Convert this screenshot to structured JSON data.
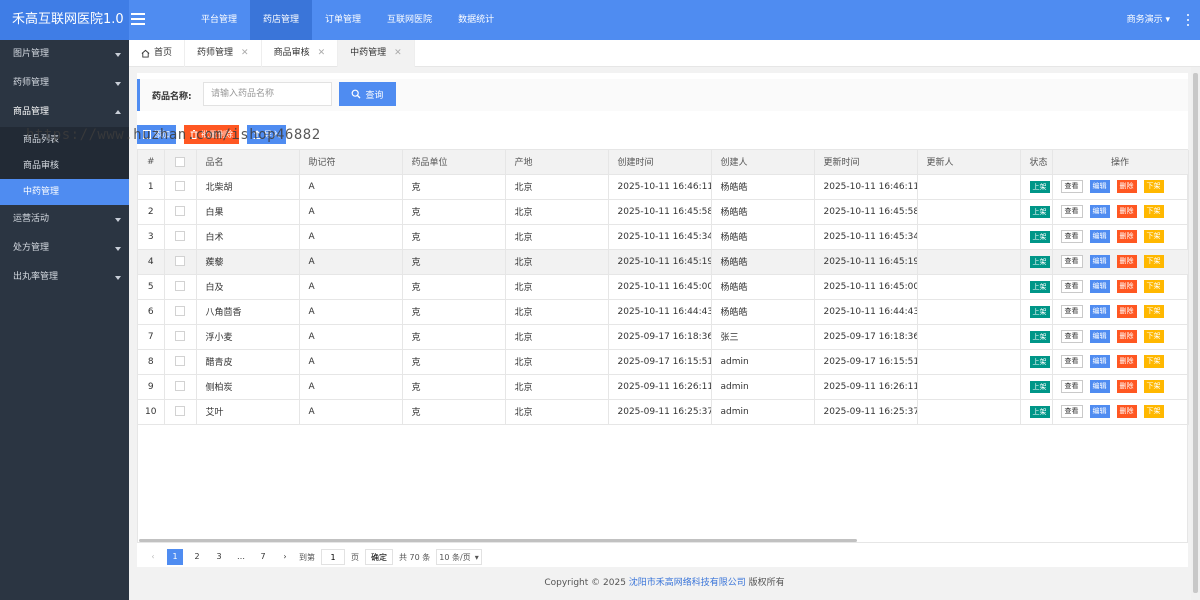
{
  "app": {
    "title": "禾高互联网医院1.0"
  },
  "topnav": {
    "items": [
      "平台管理",
      "药店管理",
      "订单管理",
      "互联网医院",
      "数据统计"
    ],
    "active_index": 1,
    "user": "商务演示"
  },
  "sidebar": {
    "items": [
      {
        "label": "图片管理",
        "state": "collapsed"
      },
      {
        "label": "药师管理",
        "state": "collapsed"
      },
      {
        "label": "商品管理",
        "state": "expanded"
      },
      {
        "label": "运营活动",
        "state": "collapsed"
      },
      {
        "label": "处方管理",
        "state": "collapsed"
      },
      {
        "label": "出丸率管理",
        "state": "collapsed"
      }
    ],
    "sub_items": [
      "商品列表",
      "商品审核",
      "中药管理"
    ],
    "active_sub": "中药管理"
  },
  "tabs": [
    {
      "label": "首页",
      "icon": "home-icon",
      "closable": false
    },
    {
      "label": "药师管理",
      "closable": true
    },
    {
      "label": "商品审核",
      "closable": true
    },
    {
      "label": "中药管理",
      "closable": true,
      "active": true
    }
  ],
  "search": {
    "label": "药品名称:",
    "placeholder": "请输入药品名称",
    "button": "查询"
  },
  "actions": {
    "add": "添加",
    "batch_delete": "批量删除",
    "import": "导入"
  },
  "watermark": "https://www.huzhan.com/ishop46882",
  "table": {
    "columns": [
      "#",
      "",
      "品名",
      "助记符",
      "药品单位",
      "产地",
      "创建时间",
      "创建人",
      "更新时间",
      "更新人",
      "状态",
      "操作"
    ],
    "status_label": "上架",
    "op_labels": {
      "view": "查看",
      "edit": "编辑",
      "delete": "删除",
      "offshelf": "下架"
    },
    "rows": [
      {
        "no": "1",
        "name": "北柴胡",
        "mnemonic": "A",
        "unit": "克",
        "origin": "北京",
        "created": "2025-10-11 16:46:11",
        "creator": "杨皓皓",
        "updated": "2025-10-11 16:46:11",
        "updater": ""
      },
      {
        "no": "2",
        "name": "白果",
        "mnemonic": "A",
        "unit": "克",
        "origin": "北京",
        "created": "2025-10-11 16:45:58",
        "creator": "杨皓皓",
        "updated": "2025-10-11 16:45:58",
        "updater": ""
      },
      {
        "no": "3",
        "name": "白术",
        "mnemonic": "A",
        "unit": "克",
        "origin": "北京",
        "created": "2025-10-11 16:45:34",
        "creator": "杨皓皓",
        "updated": "2025-10-11 16:45:34",
        "updater": ""
      },
      {
        "no": "4",
        "name": "蒺藜",
        "mnemonic": "A",
        "unit": "克",
        "origin": "北京",
        "created": "2025-10-11 16:45:19",
        "creator": "杨皓皓",
        "updated": "2025-10-11 16:45:19",
        "updater": ""
      },
      {
        "no": "5",
        "name": "白及",
        "mnemonic": "A",
        "unit": "克",
        "origin": "北京",
        "created": "2025-10-11 16:45:00",
        "creator": "杨皓皓",
        "updated": "2025-10-11 16:45:00",
        "updater": ""
      },
      {
        "no": "6",
        "name": "八角茴香",
        "mnemonic": "A",
        "unit": "克",
        "origin": "北京",
        "created": "2025-10-11 16:44:43",
        "creator": "杨皓皓",
        "updated": "2025-10-11 16:44:43",
        "updater": ""
      },
      {
        "no": "7",
        "name": "浮小麦",
        "mnemonic": "A",
        "unit": "克",
        "origin": "北京",
        "created": "2025-09-17 16:18:36",
        "creator": "张三",
        "updated": "2025-09-17 16:18:36",
        "updater": ""
      },
      {
        "no": "8",
        "name": "醋青皮",
        "mnemonic": "A",
        "unit": "克",
        "origin": "北京",
        "created": "2025-09-17 16:15:51",
        "creator": "admin",
        "updated": "2025-09-17 16:15:51",
        "updater": ""
      },
      {
        "no": "9",
        "name": "侧柏炭",
        "mnemonic": "A",
        "unit": "克",
        "origin": "北京",
        "created": "2025-09-11 16:26:11",
        "creator": "admin",
        "updated": "2025-09-11 16:26:11",
        "updater": ""
      },
      {
        "no": "10",
        "name": "艾叶",
        "mnemonic": "A",
        "unit": "克",
        "origin": "北京",
        "created": "2025-09-11 16:25:37",
        "creator": "admin",
        "updated": "2025-09-11 16:25:37",
        "updater": ""
      }
    ],
    "highlighted_row": 4
  },
  "pager": {
    "pages": [
      "1",
      "2",
      "3",
      "…",
      "7"
    ],
    "current": "1",
    "goto_label": "到第",
    "goto_value": "1",
    "page_unit": "页",
    "confirm": "确定",
    "total": "共 70 条",
    "page_size": "10 条/页"
  },
  "footer": {
    "prefix": "Copyright © 2025 ",
    "company": "沈阳市禾高网络科技有限公司",
    "suffix": " 版权所有"
  },
  "colors": {
    "primary": "#4f8cf1",
    "sidebar": "#2b3542",
    "danger": "#ff5722",
    "warn": "#ffb800",
    "success": "#009688"
  }
}
